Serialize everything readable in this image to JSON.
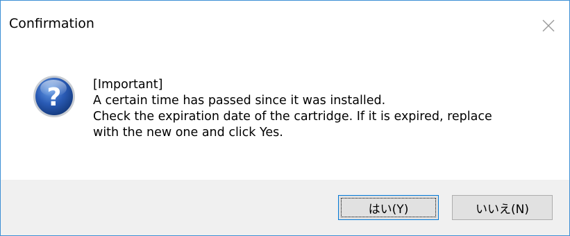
{
  "window": {
    "title": "Confirmation",
    "close_icon": "close-icon"
  },
  "message": {
    "icon": "question-icon",
    "lines": [
      "[Important]",
      "A certain time has passed since it was installed.",
      "Check the expiration date of the cartridge. If it is expired, replace",
      "with the new one and click Yes."
    ]
  },
  "buttons": {
    "yes_label": "はい(Y)",
    "no_label": "いいえ(N)"
  },
  "colors": {
    "border": "#3c8fd4",
    "footer": "#f0f0f0",
    "button": "#e1e1e1",
    "default_button_border": "#0078d7",
    "icon_blue": "#1f4fa0"
  }
}
